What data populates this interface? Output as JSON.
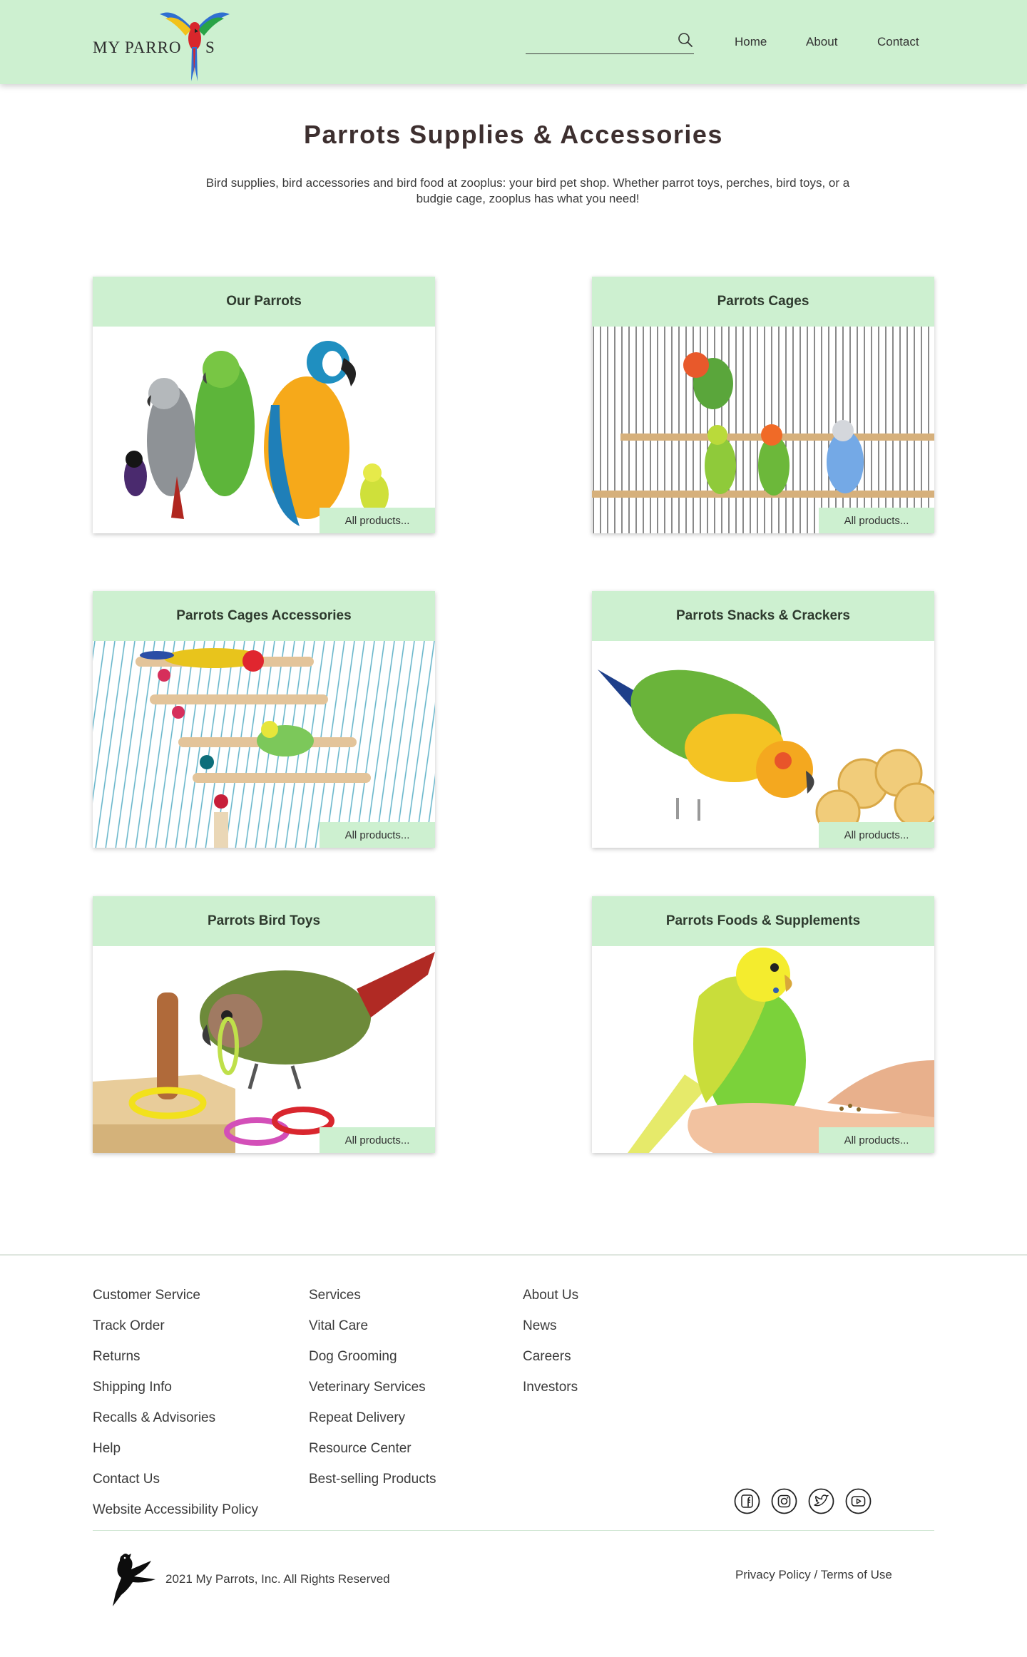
{
  "header": {
    "logo_text_a": "MY PARRO",
    "logo_text_b": "S",
    "search_value": "",
    "nav": {
      "home": "Home",
      "about": "About",
      "contact": "Contact"
    }
  },
  "intro": {
    "title": "Parrots Supplies & Accessories",
    "description": "Bird supplies, bird accessories and bird food at zooplus: your bird pet shop. Whether parrot toys, perches, bird toys, or a budgie cage, zooplus has what you need!"
  },
  "cards": [
    {
      "title": "Our Parrots",
      "link": "All products..."
    },
    {
      "title": "Parrots Cages",
      "link": "All products..."
    },
    {
      "title": "Parrots Cages Accessories",
      "link": "All products..."
    },
    {
      "title": "Parrots Snacks & Crackers",
      "link": "All products..."
    },
    {
      "title": "Parrots Bird Toys",
      "link": "All products..."
    },
    {
      "title": "Parrots Foods & Supplements",
      "link": "All products..."
    }
  ],
  "footer": {
    "col1": [
      "Customer Service",
      "Track Order",
      "Returns",
      "Shipping Info",
      "Recalls & Advisories",
      "Help",
      "Contact Us",
      "Website Accessibility Policy"
    ],
    "col2": [
      "Services",
      "Vital Care",
      "Dog Grooming",
      "Veterinary Services",
      "Repeat Delivery",
      "Resource Center",
      "Best-selling Products"
    ],
    "col3": [
      "About Us",
      "News",
      "Careers",
      "Investors"
    ],
    "social_icons": [
      "facebook-icon",
      "instagram-icon",
      "twitter-icon",
      "youtube-icon"
    ],
    "copyright": "2021 My Parrots, Inc. All Rights Reserved",
    "legal": "Privacy Policy / Terms of Use"
  },
  "colors": {
    "accent": "#cdf0d0",
    "text": "#3a3a3a",
    "title": "#3d2f2f"
  }
}
